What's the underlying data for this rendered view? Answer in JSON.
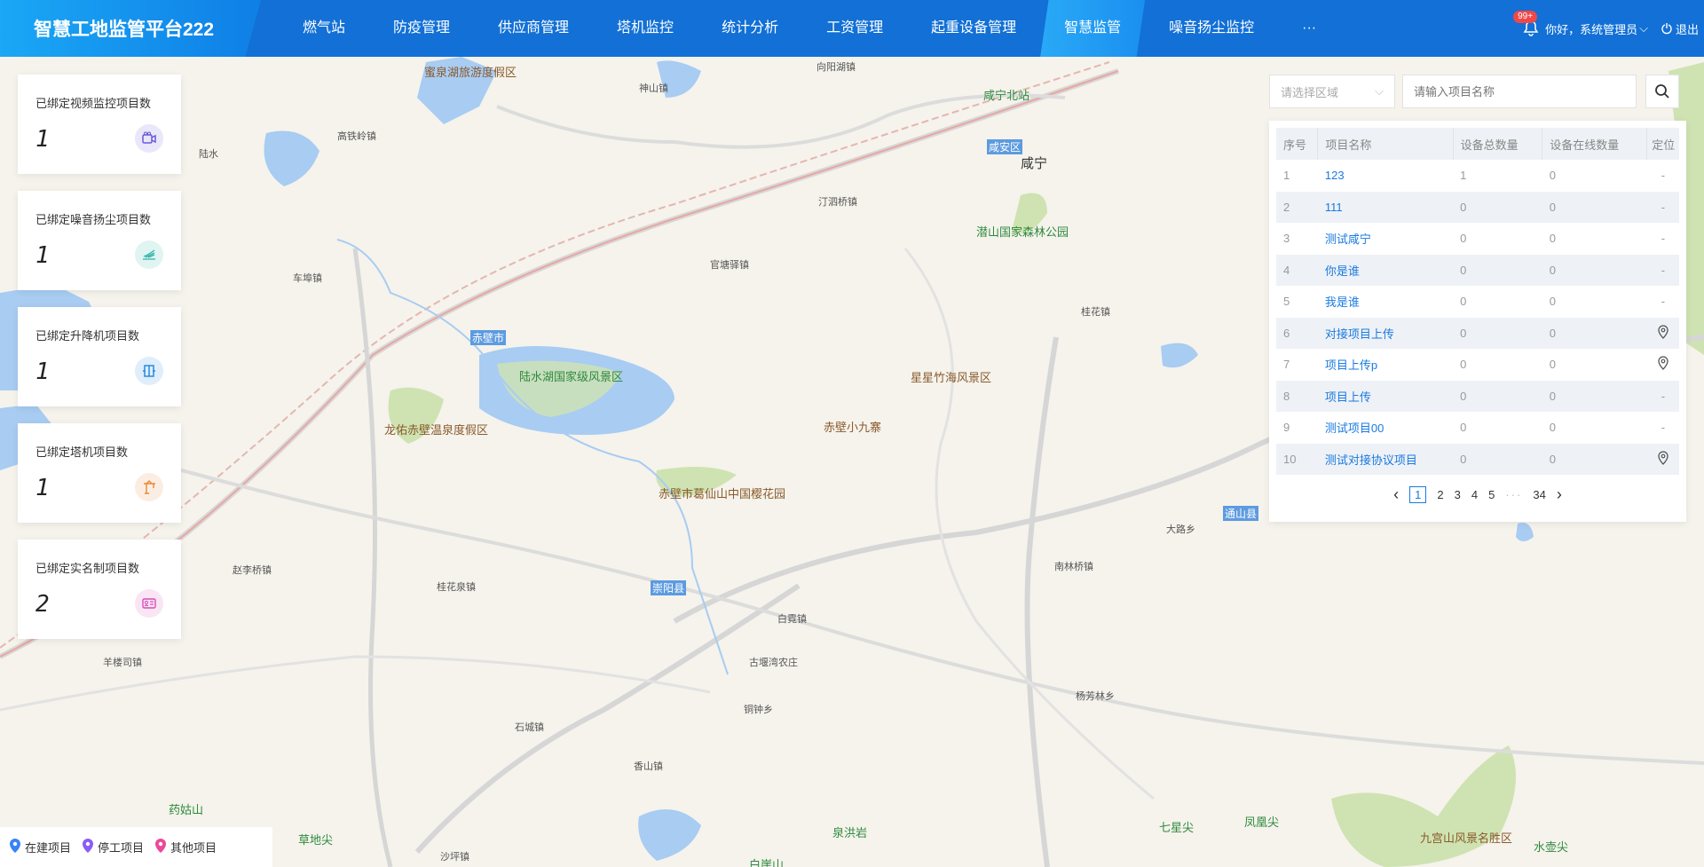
{
  "header": {
    "title": "智慧工地监管平台222",
    "nav": [
      "燃气站",
      "防疫管理",
      "供应商管理",
      "塔机监控",
      "统计分析",
      "工资管理",
      "起重设备管理",
      "智慧监管",
      "噪音扬尘监控",
      "···"
    ],
    "active_nav": "智慧监管",
    "badge": "99+",
    "user": "你好，系统管理员",
    "logout": "退出"
  },
  "stats": [
    {
      "title": "已绑定视频监控项目数",
      "value": "1",
      "icon": "video-camera-icon",
      "color": "#6b5bd6"
    },
    {
      "title": "已绑定噪音扬尘项目数",
      "value": "1",
      "icon": "dust-wave-icon",
      "color": "#2fb3a8"
    },
    {
      "title": "已绑定升降机项目数",
      "value": "1",
      "icon": "elevator-icon",
      "color": "#2a8be0"
    },
    {
      "title": "已绑定塔机项目数",
      "value": "1",
      "icon": "tower-crane-icon",
      "color": "#e8893a"
    },
    {
      "title": "已绑定实名制项目数",
      "value": "2",
      "icon": "id-card-icon",
      "color": "#d64fb8"
    }
  ],
  "search": {
    "region_placeholder": "请选择区域",
    "name_placeholder": "请输入项目名称"
  },
  "table": {
    "headers": [
      "序号",
      "项目名称",
      "设备总数量",
      "设备在线数量",
      "定位"
    ],
    "rows": [
      {
        "no": "1",
        "name": "123",
        "total": "1",
        "online": "0",
        "loc": "-"
      },
      {
        "no": "2",
        "name": "111",
        "total": "0",
        "online": "0",
        "loc": "-"
      },
      {
        "no": "3",
        "name": "测试咸宁",
        "total": "0",
        "online": "0",
        "loc": "-"
      },
      {
        "no": "4",
        "name": "你是谁",
        "total": "0",
        "online": "0",
        "loc": "-"
      },
      {
        "no": "5",
        "name": "我是谁",
        "total": "0",
        "online": "0",
        "loc": "-"
      },
      {
        "no": "6",
        "name": "对接项目上传",
        "total": "0",
        "online": "0",
        "loc": "pin"
      },
      {
        "no": "7",
        "name": "项目上传p",
        "total": "0",
        "online": "0",
        "loc": "pin"
      },
      {
        "no": "8",
        "name": "项目上传",
        "total": "0",
        "online": "0",
        "loc": "-"
      },
      {
        "no": "9",
        "name": "测试项目00",
        "total": "0",
        "online": "0",
        "loc": "-"
      },
      {
        "no": "10",
        "name": "测试对接协议项目",
        "total": "0",
        "online": "0",
        "loc": "pin"
      }
    ]
  },
  "pagination": {
    "pages": [
      "1",
      "2",
      "3",
      "4",
      "5"
    ],
    "current": "1",
    "last": "34",
    "ellipsis": "···"
  },
  "legend": [
    {
      "label": "在建项目",
      "color": "#3b82f6"
    },
    {
      "label": "停工项目",
      "color": "#8b5cf6"
    },
    {
      "label": "其他项目",
      "color": "#ec4899"
    }
  ],
  "map_labels": [
    {
      "text": "蜜泉湖旅游度假区",
      "cls": "scenic",
      "pos": [
        478,
        71
      ]
    },
    {
      "text": "咸宁北站",
      "cls": "park",
      "pos": [
        1108,
        97
      ]
    },
    {
      "text": "咸安区",
      "cls": "county",
      "pos": [
        1112,
        157
      ]
    },
    {
      "text": "咸宁",
      "cls": "city",
      "pos": [
        1150,
        173
      ]
    },
    {
      "text": "潜山国家森林公园",
      "cls": "park",
      "pos": [
        1100,
        251
      ]
    },
    {
      "text": "赤壁市",
      "cls": "county",
      "pos": [
        530,
        372
      ]
    },
    {
      "text": "陆水湖国家级风景区",
      "cls": "park",
      "pos": [
        585,
        414
      ]
    },
    {
      "text": "星星竹海风景区",
      "cls": "scenic",
      "pos": [
        1026,
        415
      ]
    },
    {
      "text": "龙佑赤壁温泉度假区",
      "cls": "scenic",
      "pos": [
        433,
        474
      ]
    },
    {
      "text": "赤壁小九寨",
      "cls": "scenic",
      "pos": [
        928,
        471
      ]
    },
    {
      "text": "赤壁市葛仙山中国樱花园",
      "cls": "scenic",
      "pos": [
        742,
        546
      ]
    },
    {
      "text": "崇阳县",
      "cls": "county",
      "pos": [
        733,
        654
      ]
    },
    {
      "text": "通山县",
      "cls": "county",
      "pos": [
        1378,
        570
      ]
    },
    {
      "text": "古堰湾农庄",
      "cls": "",
      "pos": [
        844,
        738
      ]
    },
    {
      "text": "桂花泉镇",
      "cls": "",
      "pos": [
        492,
        653
      ]
    },
    {
      "text": "南林桥镇",
      "cls": "",
      "pos": [
        1188,
        630
      ]
    },
    {
      "text": "大路乡",
      "cls": "",
      "pos": [
        1314,
        588
      ]
    },
    {
      "text": "白霓镇",
      "cls": "",
      "pos": [
        876,
        689
      ]
    },
    {
      "text": "高铁岭镇",
      "cls": "",
      "pos": [
        380,
        145
      ]
    },
    {
      "text": "汀泗桥镇",
      "cls": "",
      "pos": [
        922,
        219
      ]
    },
    {
      "text": "官塘驿镇",
      "cls": "",
      "pos": [
        800,
        290
      ]
    },
    {
      "text": "车埠镇",
      "cls": "",
      "pos": [
        330,
        305
      ]
    },
    {
      "text": "赵李桥镇",
      "cls": "",
      "pos": [
        262,
        634
      ]
    },
    {
      "text": "羊楼司镇",
      "cls": "",
      "pos": [
        116,
        738
      ]
    },
    {
      "text": "桂花镇",
      "cls": "",
      "pos": [
        1218,
        343
      ]
    },
    {
      "text": "杨芳林乡",
      "cls": "",
      "pos": [
        1212,
        776
      ]
    },
    {
      "text": "铜钟乡",
      "cls": "",
      "pos": [
        838,
        791
      ]
    },
    {
      "text": "石城镇",
      "cls": "",
      "pos": [
        580,
        811
      ]
    },
    {
      "text": "香山镇",
      "cls": "",
      "pos": [
        714,
        855
      ]
    },
    {
      "text": "沙坪镇",
      "cls": "",
      "pos": [
        496,
        957
      ]
    },
    {
      "text": "药姑山",
      "cls": "park",
      "pos": [
        190,
        902
      ]
    },
    {
      "text": "草地尖",
      "cls": "park",
      "pos": [
        336,
        936
      ]
    },
    {
      "text": "泉洪岩",
      "cls": "park",
      "pos": [
        938,
        928
      ]
    },
    {
      "text": "白崖山",
      "cls": "park",
      "pos": [
        844,
        964
      ]
    },
    {
      "text": "七星尖",
      "cls": "park",
      "pos": [
        1306,
        922
      ]
    },
    {
      "text": "凤凰尖",
      "cls": "park",
      "pos": [
        1402,
        916
      ]
    },
    {
      "text": "九宫山风景名胜区",
      "cls": "scenic",
      "pos": [
        1600,
        934
      ]
    },
    {
      "text": "水壶尖",
      "cls": "park",
      "pos": [
        1728,
        944
      ]
    },
    {
      "text": "神山镇",
      "cls": "",
      "pos": [
        720,
        91
      ]
    },
    {
      "text": "向阳湖镇",
      "cls": "",
      "pos": [
        920,
        67
      ]
    },
    {
      "text": "陆水",
      "cls": "",
      "pos": [
        224,
        165
      ]
    }
  ]
}
